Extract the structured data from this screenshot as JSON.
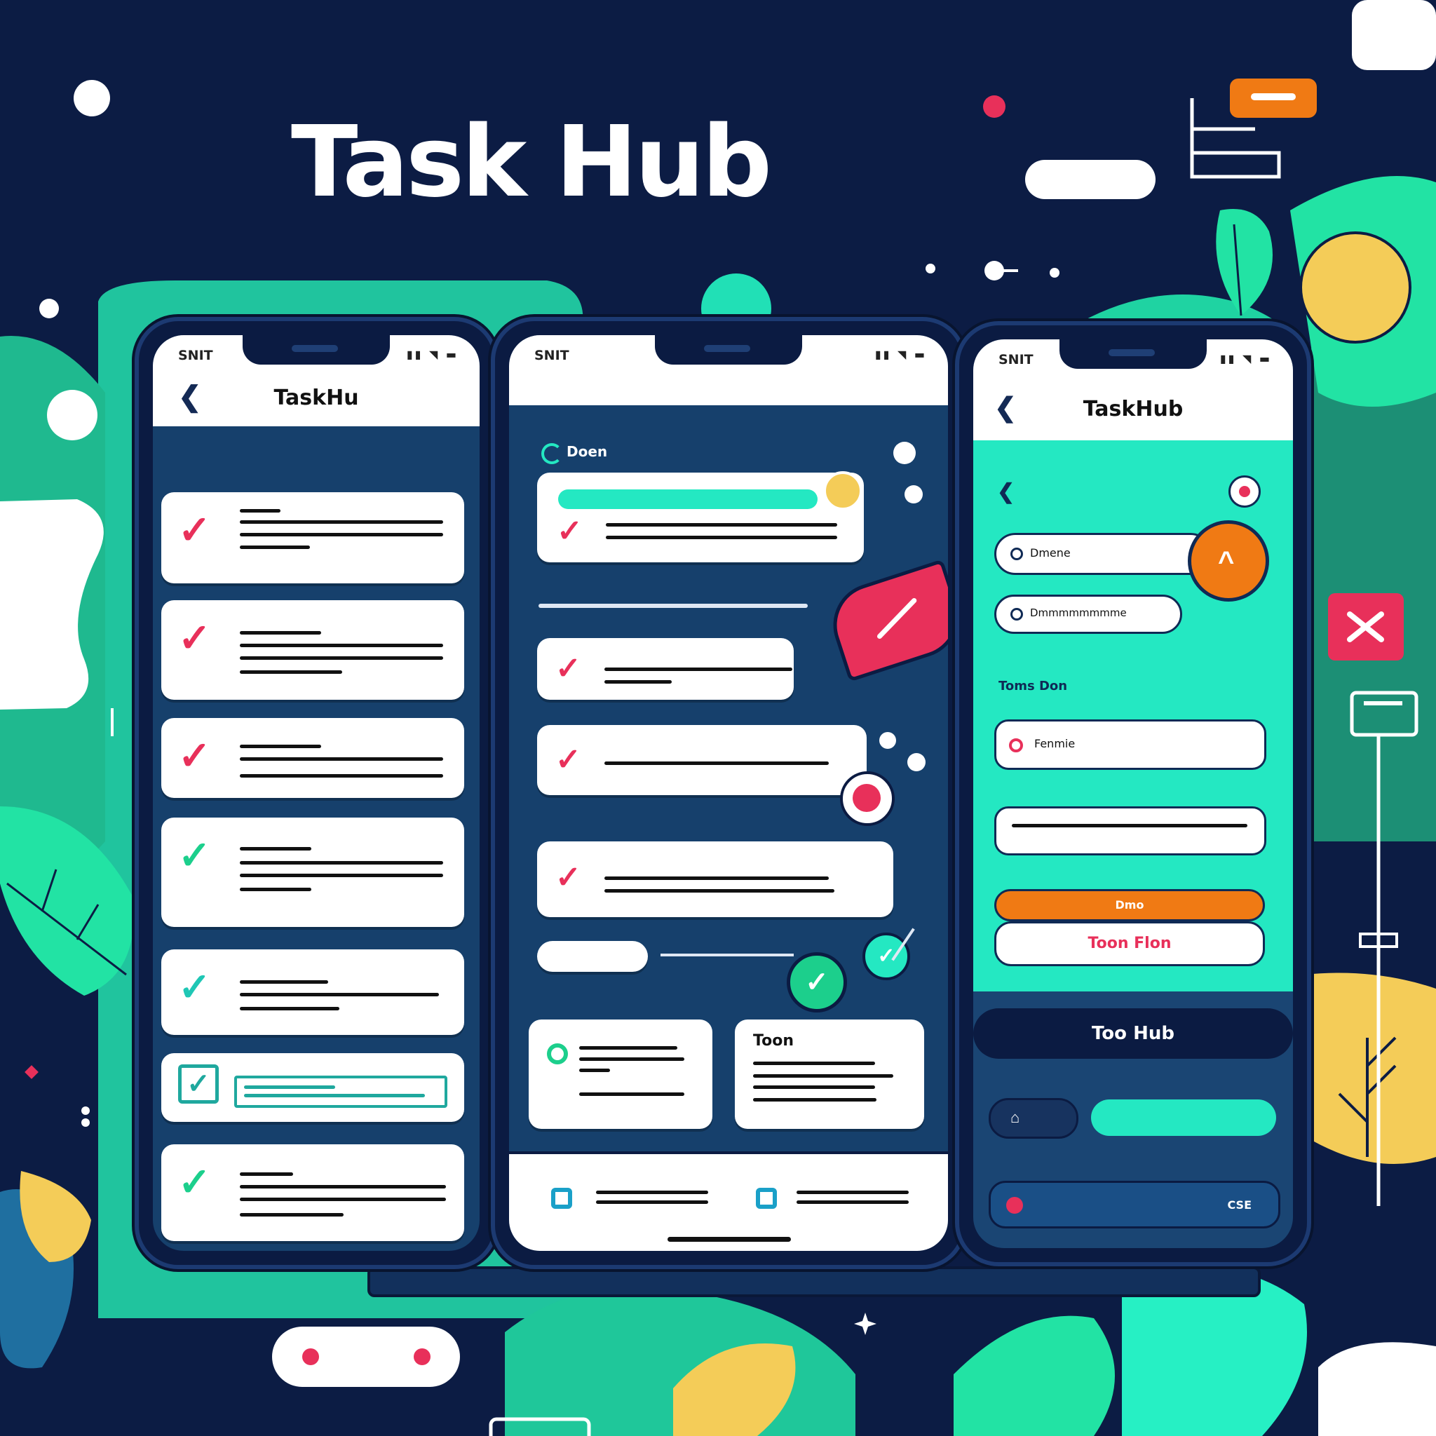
{
  "title": "Task Hub",
  "colors": {
    "background": "#0c1c44",
    "accent_teal": "#24e8c2",
    "accent_red": "#e8305a",
    "accent_orange": "#f07a14",
    "accent_yellow": "#f4cc58",
    "check_green": "#1ccf8c"
  },
  "phone_left": {
    "status_time": "SNIT",
    "status_icons": "▮▮ ◥ ▬",
    "back_icon": "chevron-left-icon",
    "app_title": "TaskHu",
    "tasks": [
      {
        "check": "✓",
        "check_color": "#e8305a"
      },
      {
        "check": "✓",
        "check_color": "#e8305a"
      },
      {
        "check": "✓",
        "check_color": "#e8305a"
      },
      {
        "check": "✓",
        "check_color": "#1ccf8c"
      },
      {
        "check": "✓",
        "check_color": "#1fc7b5"
      },
      {
        "check": "✓",
        "check_color": "#1fa89e"
      },
      {
        "check": "✓",
        "check_color": "#1ccf8c"
      }
    ]
  },
  "phone_middle": {
    "status_time": "SNIT",
    "status_icons": "▮▮ ◥ ▬",
    "section_label": "Doen",
    "mini_card_title": "Toon",
    "check": "✓"
  },
  "phone_right": {
    "status_time": "SNIT",
    "status_icons": "▮▮ ◥ ▬",
    "app_title": "TaskHub",
    "field_1": "Dmene",
    "field_2": "Dmmmmmmmme",
    "section_label": "Toms Don",
    "field_3": "Fenmie",
    "button_orange": "Dmo",
    "button_white": "Toon Flon",
    "dark_button": "Too Hub",
    "bottom_label": "CSE"
  }
}
